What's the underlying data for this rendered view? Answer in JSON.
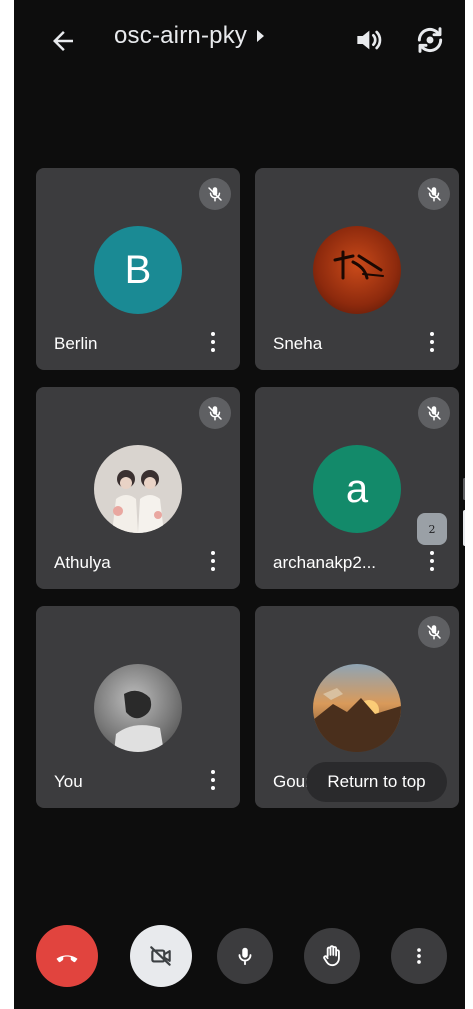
{
  "meeting": {
    "code": "osc-airn-pky"
  },
  "participants": [
    {
      "name": "Berlin",
      "initial": "B",
      "avatar_color": "#1a8a94",
      "muted": true
    },
    {
      "name": "Sneha",
      "avatar_color": "#9b2c12",
      "muted": true
    },
    {
      "name": "Athulya",
      "avatar_color": "#d8d2cc",
      "muted": true
    },
    {
      "name": "archanakp2...",
      "initial": "a",
      "avatar_color": "#138a6a",
      "muted": true
    },
    {
      "name": "You",
      "avatar_color": "#6e6e6e",
      "muted": false
    },
    {
      "name": "Gouri",
      "avatar_color": "#b86e38",
      "muted": true
    }
  ],
  "grid": {
    "page_badge": "2",
    "return_to_top_label": "Return to top"
  },
  "controls": {
    "end_call_color": "#e1443e",
    "camera_off_bg": "#e8eaed",
    "button_bg": "#3c3c3e"
  },
  "icons": [
    "back-arrow-icon",
    "dropdown-caret-icon",
    "speaker-icon",
    "flip-camera-icon",
    "mic-off-icon",
    "more-vert-icon",
    "end-call-icon",
    "camera-off-icon",
    "mic-icon",
    "raise-hand-icon"
  ]
}
